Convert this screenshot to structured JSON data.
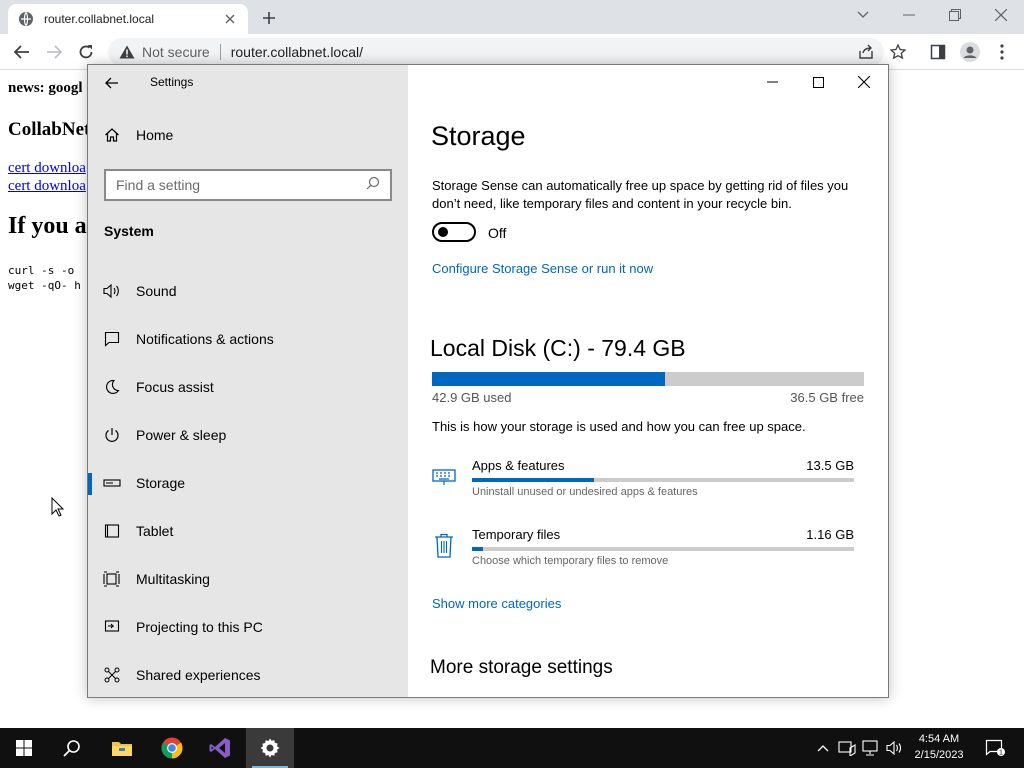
{
  "browser": {
    "tab_title": "router.collabnet.local",
    "security_label": "Not secure",
    "url": "router.collabnet.local/"
  },
  "webpage": {
    "news": "news: googl",
    "heading": "CollabNet",
    "links": [
      "cert downloa",
      "cert downloa"
    ],
    "big_heading": "If you a",
    "code_lines": [
      "curl -s -o",
      "wget -qO- h"
    ]
  },
  "settings": {
    "app_title": "Settings",
    "home_label": "Home",
    "search_placeholder": "Find a setting",
    "section_label": "System",
    "nav_items": [
      {
        "label": "Sound",
        "icon": "speaker-icon"
      },
      {
        "label": "Notifications & actions",
        "icon": "notification-icon"
      },
      {
        "label": "Focus assist",
        "icon": "moon-icon"
      },
      {
        "label": "Power & sleep",
        "icon": "power-icon"
      },
      {
        "label": "Storage",
        "icon": "drive-icon",
        "active": true
      },
      {
        "label": "Tablet",
        "icon": "tablet-icon"
      },
      {
        "label": "Multitasking",
        "icon": "multitasking-icon"
      },
      {
        "label": "Projecting to this PC",
        "icon": "projector-icon"
      },
      {
        "label": "Shared experiences",
        "icon": "share-icon"
      }
    ],
    "content": {
      "title": "Storage",
      "description": "Storage Sense can automatically free up space by getting rid of files you don’t need, like temporary files and content in your recycle bin.",
      "toggle_state": "Off",
      "configure_link": "Configure Storage Sense or run it now",
      "disk_title": "Local Disk (C:) - 79.4 GB",
      "disk_used_fraction": 0.54,
      "disk_used": "42.9 GB used",
      "disk_free": "36.5 GB free",
      "explain": "This is how your storage is used and how you can free up space.",
      "categories": [
        {
          "name": "Apps & features",
          "size": "13.5 GB",
          "sub": "Uninstall unused or undesired apps & features",
          "fraction": 0.32,
          "icon": "keyboard-icon"
        },
        {
          "name": "Temporary files",
          "size": "1.16 GB",
          "sub": "Choose which temporary files to remove",
          "fraction": 0.03,
          "icon": "trash-icon"
        }
      ],
      "show_more_link": "Show more categories",
      "more_settings": "More storage settings"
    }
  },
  "taskbar": {
    "time": "4:54 AM",
    "date": "2/15/2023",
    "notification_count": "1"
  },
  "colors": {
    "accent": "#0067c0",
    "link": "#0067b8",
    "nav_bg": "#e6e6e6",
    "taskbar_bg": "#101010"
  }
}
